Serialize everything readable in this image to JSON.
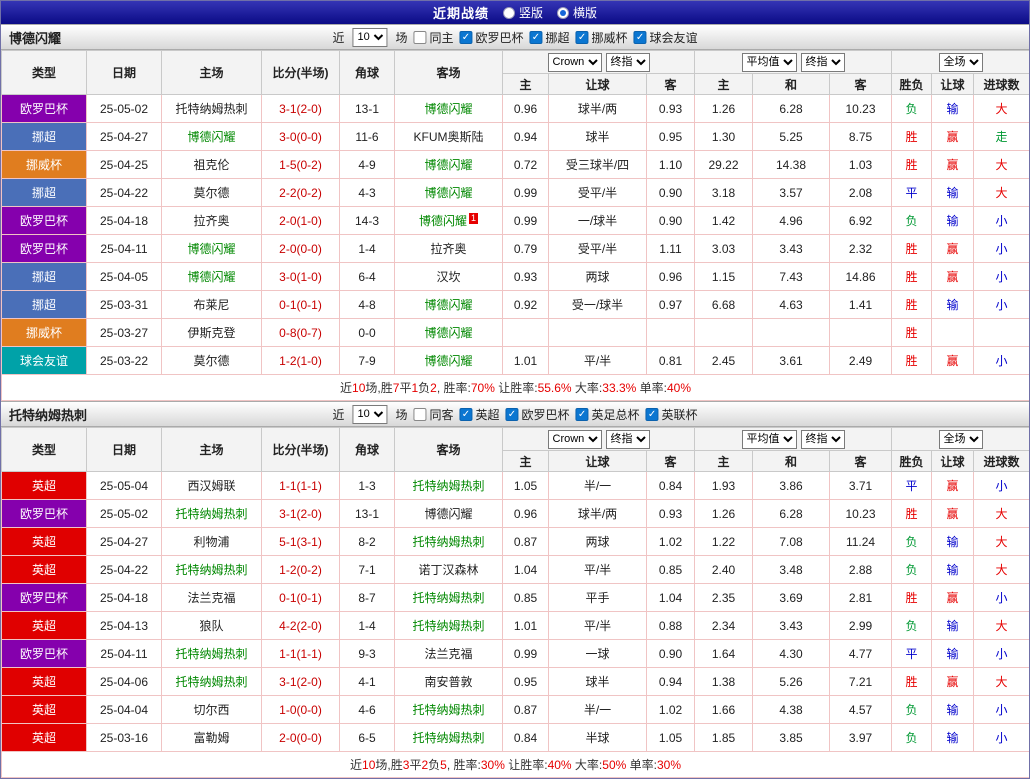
{
  "topbar": {
    "title": "近期战绩",
    "vertical_label": "竖版",
    "horizontal_label": "横版",
    "selected": "横版"
  },
  "table_header": {
    "type": "类型",
    "date": "日期",
    "home": "主场",
    "score": "比分(半场)",
    "corner": "角球",
    "away": "客场",
    "odds_company": "Crown",
    "odds_final": "终指",
    "avg": "平均值",
    "avg_final": "终指",
    "full": "全场",
    "sub": [
      "主",
      "让球",
      "客",
      "主",
      "和",
      "客",
      "胜负",
      "让球",
      "进球数"
    ]
  },
  "colors": {
    "accent_red": "#e60000",
    "leagues": {
      "欧罗巴杯": "#8500ad",
      "挪超": "#4a6fb8",
      "挪威杯": "#e07d1f",
      "球会友谊": "#00a2a8",
      "英超": "#e00000"
    },
    "results": {
      "胜": "#e60000",
      "平": "#0000cc",
      "负": "#009933",
      "赢": "#e60000",
      "输": "#0000cc",
      "走": "#009933",
      "大": "#e60000",
      "小": "#0000cc"
    }
  },
  "sections": [
    {
      "team": "博德闪耀",
      "filter": {
        "near": "近",
        "count": "10",
        "games": "场",
        "same": "同主",
        "same_checked": false,
        "leagues": [
          "欧罗巴杯",
          "挪超",
          "挪威杯",
          "球会友谊"
        ]
      },
      "rows": [
        {
          "league": "欧罗巴杯",
          "date": "25-05-02",
          "home": "托特纳姆热刺",
          "home_green": false,
          "score": "3-1(2-0)",
          "corner": "13-1",
          "away": "博德闪耀",
          "away_green": true,
          "odds": [
            "0.96",
            "球半/两",
            "0.93"
          ],
          "avg": [
            "1.26",
            "6.28",
            "10.23"
          ],
          "res": [
            "负",
            "输",
            "大"
          ]
        },
        {
          "league": "挪超",
          "date": "25-04-27",
          "home": "博德闪耀",
          "home_green": true,
          "score": "3-0(0-0)",
          "corner": "11-6",
          "away": "KFUM奥斯陆",
          "away_green": false,
          "odds": [
            "0.94",
            "球半",
            "0.95"
          ],
          "avg": [
            "1.30",
            "5.25",
            "8.75"
          ],
          "res": [
            "胜",
            "赢",
            "走"
          ]
        },
        {
          "league": "挪威杯",
          "date": "25-04-25",
          "home": "祖克伦",
          "home_green": false,
          "score": "1-5(0-2)",
          "corner": "4-9",
          "away": "博德闪耀",
          "away_green": true,
          "odds": [
            "0.72",
            "受三球半/四",
            "1.10"
          ],
          "avg": [
            "29.22",
            "14.38",
            "1.03"
          ],
          "res": [
            "胜",
            "赢",
            "大"
          ]
        },
        {
          "league": "挪超",
          "date": "25-04-22",
          "home": "莫尔德",
          "home_green": false,
          "score": "2-2(0-2)",
          "corner": "4-3",
          "away": "博德闪耀",
          "away_green": true,
          "odds": [
            "0.99",
            "受平/半",
            "0.90"
          ],
          "avg": [
            "3.18",
            "3.57",
            "2.08"
          ],
          "res": [
            "平",
            "输",
            "大"
          ]
        },
        {
          "league": "欧罗巴杯",
          "date": "25-04-18",
          "home": "拉齐奥",
          "home_green": false,
          "score": "2-0(1-0)",
          "corner": "14-3",
          "away": "博德闪耀",
          "away_green": true,
          "away_sup": "1",
          "odds": [
            "0.99",
            "一/球半",
            "0.90"
          ],
          "avg": [
            "1.42",
            "4.96",
            "6.92"
          ],
          "res": [
            "负",
            "输",
            "小"
          ]
        },
        {
          "league": "欧罗巴杯",
          "date": "25-04-11",
          "home": "博德闪耀",
          "home_green": true,
          "score": "2-0(0-0)",
          "corner": "1-4",
          "away": "拉齐奥",
          "away_green": false,
          "odds": [
            "0.79",
            "受平/半",
            "1.11"
          ],
          "avg": [
            "3.03",
            "3.43",
            "2.32"
          ],
          "res": [
            "胜",
            "赢",
            "小"
          ]
        },
        {
          "league": "挪超",
          "date": "25-04-05",
          "home": "博德闪耀",
          "home_green": true,
          "score": "3-0(1-0)",
          "corner": "6-4",
          "away": "汉坎",
          "away_green": false,
          "odds": [
            "0.93",
            "两球",
            "0.96"
          ],
          "avg": [
            "1.15",
            "7.43",
            "14.86"
          ],
          "res": [
            "胜",
            "赢",
            "小"
          ]
        },
        {
          "league": "挪超",
          "date": "25-03-31",
          "home": "布莱尼",
          "home_green": false,
          "score": "0-1(0-1)",
          "corner": "4-8",
          "away": "博德闪耀",
          "away_green": true,
          "odds": [
            "0.92",
            "受一/球半",
            "0.97"
          ],
          "avg": [
            "6.68",
            "4.63",
            "1.41"
          ],
          "res": [
            "胜",
            "输",
            "小"
          ]
        },
        {
          "league": "挪威杯",
          "date": "25-03-27",
          "home": "伊斯克登",
          "home_green": false,
          "score": "0-8(0-7)",
          "corner": "0-0",
          "away": "博德闪耀",
          "away_green": true,
          "odds": [
            "",
            "",
            ""
          ],
          "avg": [
            "",
            "",
            ""
          ],
          "res": [
            "胜",
            "",
            ""
          ]
        },
        {
          "league": "球会友谊",
          "date": "25-03-22",
          "home": "莫尔德",
          "home_green": false,
          "score": "1-2(1-0)",
          "corner": "7-9",
          "away": "博德闪耀",
          "away_green": true,
          "odds": [
            "1.01",
            "平/半",
            "0.81"
          ],
          "avg": [
            "2.45",
            "3.61",
            "2.49"
          ],
          "res": [
            "胜",
            "赢",
            "小"
          ]
        }
      ],
      "summary": [
        [
          "近",
          0
        ],
        [
          "10",
          1
        ],
        [
          "场,胜",
          0
        ],
        [
          "7",
          1
        ],
        [
          "平",
          0
        ],
        [
          "1",
          1
        ],
        [
          "负",
          0
        ],
        [
          "2",
          1
        ],
        [
          ", 胜率:",
          0
        ],
        [
          "70%",
          1
        ],
        [
          " 让胜率:",
          0
        ],
        [
          "55.6%",
          1
        ],
        [
          " 大率:",
          0
        ],
        [
          "33.3%",
          1
        ],
        [
          " 单率:",
          0
        ],
        [
          "40%",
          1
        ]
      ]
    },
    {
      "team": "托特纳姆热刺",
      "filter": {
        "near": "近",
        "count": "10",
        "games": "场",
        "same": "同客",
        "same_checked": false,
        "leagues": [
          "英超",
          "欧罗巴杯",
          "英足总杯",
          "英联杯"
        ]
      },
      "rows": [
        {
          "league": "英超",
          "date": "25-05-04",
          "home": "西汉姆联",
          "home_green": false,
          "score": "1-1(1-1)",
          "corner": "1-3",
          "away": "托特纳姆热刺",
          "away_green": true,
          "odds": [
            "1.05",
            "半/一",
            "0.84"
          ],
          "avg": [
            "1.93",
            "3.86",
            "3.71"
          ],
          "res": [
            "平",
            "赢",
            "小"
          ]
        },
        {
          "league": "欧罗巴杯",
          "date": "25-05-02",
          "home": "托特纳姆热刺",
          "home_green": true,
          "score": "3-1(2-0)",
          "corner": "13-1",
          "away": "博德闪耀",
          "away_green": false,
          "odds": [
            "0.96",
            "球半/两",
            "0.93"
          ],
          "avg": [
            "1.26",
            "6.28",
            "10.23"
          ],
          "res": [
            "胜",
            "赢",
            "大"
          ]
        },
        {
          "league": "英超",
          "date": "25-04-27",
          "home": "利物浦",
          "home_green": false,
          "score": "5-1(3-1)",
          "corner": "8-2",
          "away": "托特纳姆热刺",
          "away_green": true,
          "odds": [
            "0.87",
            "两球",
            "1.02"
          ],
          "avg": [
            "1.22",
            "7.08",
            "11.24"
          ],
          "res": [
            "负",
            "输",
            "大"
          ]
        },
        {
          "league": "英超",
          "date": "25-04-22",
          "home": "托特纳姆热刺",
          "home_green": true,
          "score": "1-2(0-2)",
          "corner": "7-1",
          "away": "诺丁汉森林",
          "away_green": false,
          "odds": [
            "1.04",
            "平/半",
            "0.85"
          ],
          "avg": [
            "2.40",
            "3.48",
            "2.88"
          ],
          "res": [
            "负",
            "输",
            "大"
          ]
        },
        {
          "league": "欧罗巴杯",
          "date": "25-04-18",
          "home": "法兰克福",
          "home_green": false,
          "score": "0-1(0-1)",
          "corner": "8-7",
          "away": "托特纳姆热刺",
          "away_green": true,
          "odds": [
            "0.85",
            "平手",
            "1.04"
          ],
          "avg": [
            "2.35",
            "3.69",
            "2.81"
          ],
          "res": [
            "胜",
            "赢",
            "小"
          ]
        },
        {
          "league": "英超",
          "date": "25-04-13",
          "home": "狼队",
          "home_green": false,
          "score": "4-2(2-0)",
          "corner": "1-4",
          "away": "托特纳姆热刺",
          "away_green": true,
          "odds": [
            "1.01",
            "平/半",
            "0.88"
          ],
          "avg": [
            "2.34",
            "3.43",
            "2.99"
          ],
          "res": [
            "负",
            "输",
            "大"
          ]
        },
        {
          "league": "欧罗巴杯",
          "date": "25-04-11",
          "home": "托特纳姆热刺",
          "home_green": true,
          "score": "1-1(1-1)",
          "corner": "9-3",
          "away": "法兰克福",
          "away_green": false,
          "odds": [
            "0.99",
            "一球",
            "0.90"
          ],
          "avg": [
            "1.64",
            "4.30",
            "4.77"
          ],
          "res": [
            "平",
            "输",
            "小"
          ]
        },
        {
          "league": "英超",
          "date": "25-04-06",
          "home": "托特纳姆热刺",
          "home_green": true,
          "score": "3-1(2-0)",
          "corner": "4-1",
          "away": "南安普敦",
          "away_green": false,
          "odds": [
            "0.95",
            "球半",
            "0.94"
          ],
          "avg": [
            "1.38",
            "5.26",
            "7.21"
          ],
          "res": [
            "胜",
            "赢",
            "大"
          ]
        },
        {
          "league": "英超",
          "date": "25-04-04",
          "home": "切尔西",
          "home_green": false,
          "score": "1-0(0-0)",
          "corner": "4-6",
          "away": "托特纳姆热刺",
          "away_green": true,
          "odds": [
            "0.87",
            "半/一",
            "1.02"
          ],
          "avg": [
            "1.66",
            "4.38",
            "4.57"
          ],
          "res": [
            "负",
            "输",
            "小"
          ]
        },
        {
          "league": "英超",
          "date": "25-03-16",
          "home": "富勒姆",
          "home_green": false,
          "score": "2-0(0-0)",
          "corner": "6-5",
          "away": "托特纳姆热刺",
          "away_green": true,
          "odds": [
            "0.84",
            "半球",
            "1.05"
          ],
          "avg": [
            "1.85",
            "3.85",
            "3.97"
          ],
          "res": [
            "负",
            "输",
            "小"
          ]
        }
      ],
      "summary": [
        [
          "近",
          0
        ],
        [
          "10",
          1
        ],
        [
          "场,胜",
          0
        ],
        [
          "3",
          1
        ],
        [
          "平",
          0
        ],
        [
          "2",
          1
        ],
        [
          "负",
          0
        ],
        [
          "5",
          1
        ],
        [
          ", 胜率:",
          0
        ],
        [
          "30%",
          1
        ],
        [
          " 让胜率:",
          0
        ],
        [
          "40%",
          1
        ],
        [
          " 大率:",
          0
        ],
        [
          "50%",
          1
        ],
        [
          " 单率:",
          0
        ],
        [
          "30%",
          1
        ]
      ]
    }
  ]
}
